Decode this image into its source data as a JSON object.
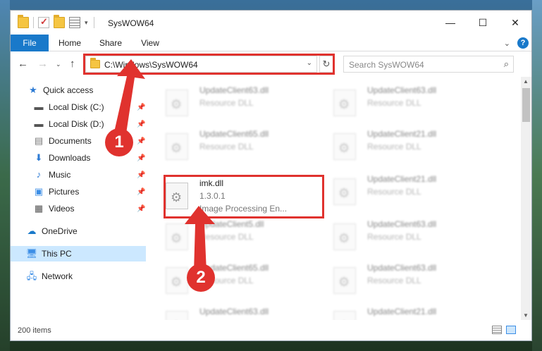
{
  "window": {
    "title": "SysWOW64",
    "controls": {
      "minimize": "—",
      "maximize": "☐",
      "close": "✕"
    }
  },
  "ribbon": {
    "tabs": [
      "File",
      "Home",
      "Share",
      "View"
    ],
    "collapse": "⌄",
    "help": "?"
  },
  "address_bar": {
    "path": "C:\\Windows\\SysWOW64",
    "search_placeholder": "Search SysWOW64"
  },
  "nav": {
    "items": [
      {
        "label": "Quick access",
        "icon": "star-icon",
        "pinned": false
      },
      {
        "label": "Local Disk (C:)",
        "icon": "drive-icon",
        "pinned": true
      },
      {
        "label": "Local Disk (D:)",
        "icon": "drive-icon",
        "pinned": true
      },
      {
        "label": "Documents",
        "icon": "documents-icon",
        "pinned": true
      },
      {
        "label": "Downloads",
        "icon": "download-icon",
        "pinned": true
      },
      {
        "label": "Music",
        "icon": "music-icon",
        "pinned": true
      },
      {
        "label": "Pictures",
        "icon": "pictures-icon",
        "pinned": true
      },
      {
        "label": "Videos",
        "icon": "videos-icon",
        "pinned": true
      },
      {
        "label": "OneDrive",
        "icon": "cloud-icon"
      },
      {
        "label": "This PC",
        "icon": "computer-icon",
        "selected": true
      },
      {
        "label": "Network",
        "icon": "network-icon"
      }
    ]
  },
  "files": [
    {
      "name": "UpdateClient63.dll",
      "type": "Resource DLL",
      "blurred": true
    },
    {
      "name": "UpdateClient63.dll",
      "type": "Resource DLL",
      "blurred": true
    },
    {
      "name": "UpdateClient65.dll",
      "type": "Resource DLL",
      "blurred": true
    },
    {
      "name": "UpdateClient21.dll",
      "type": "Resource DLL",
      "blurred": true
    },
    {
      "name": "imk.dll",
      "version": "1.3.0.1",
      "type": "Image Processing En...",
      "blurred": false,
      "highlighted": true
    },
    {
      "name": "UpdateClient21.dll",
      "type": "Resource DLL",
      "blurred": true
    },
    {
      "name": "UpdateClient5.dll",
      "type": "Resource DLL",
      "blurred": true
    },
    {
      "name": "UpdateClient63.dll",
      "type": "Resource DLL",
      "blurred": true
    },
    {
      "name": "UpdateClient65.dll",
      "type": "Resource DLL",
      "blurred": true
    },
    {
      "name": "UpdateClient63.dll",
      "type": "Resource DLL",
      "blurred": true
    },
    {
      "name": "UpdateClient63.dll",
      "type": "Resource DLL",
      "blurred": true
    },
    {
      "name": "UpdateClient21.dll",
      "type": "Resource DLL",
      "blurred": true
    }
  ],
  "status": {
    "item_count": "200 items"
  },
  "annotations": {
    "step1": "1",
    "step2": "2",
    "color": "#e0322e"
  }
}
